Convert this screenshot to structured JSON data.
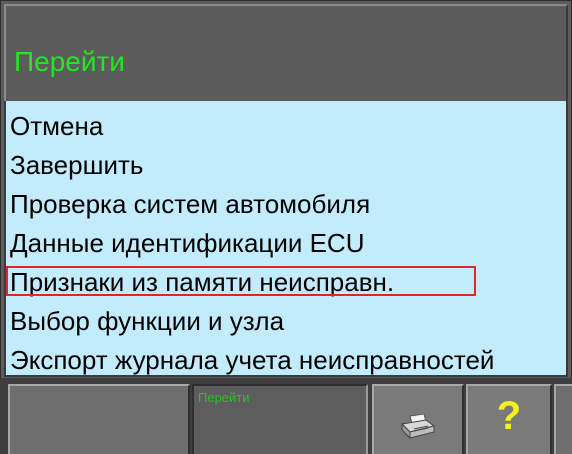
{
  "header": {
    "title": "Перейти"
  },
  "menu": {
    "items": [
      {
        "label": "Отмена"
      },
      {
        "label": "Завершить"
      },
      {
        "label": "Проверка систем автомобиля"
      },
      {
        "label": "Данные идентификации ECU"
      },
      {
        "label": "Признаки из памяти неисправн.",
        "selected": true
      },
      {
        "label": "Выбор функции и узла"
      },
      {
        "label": "Экспорт журнала учета неисправностей"
      }
    ]
  },
  "function_bar": {
    "active_label": "Перейти",
    "print_icon": "printer-icon",
    "help_label": "?"
  },
  "colors": {
    "title_text": "#21e721",
    "menu_background": "#c2ecfb",
    "selection_border": "#e1232a",
    "help_question_mark": "#f5ef1b"
  }
}
